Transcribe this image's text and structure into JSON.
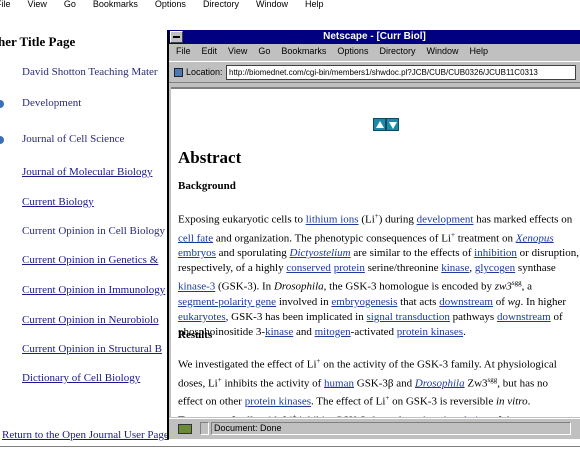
{
  "back_window": {
    "menu": [
      "File",
      "View",
      "Go",
      "Bookmarks",
      "Options",
      "Directory",
      "Window",
      "Help"
    ],
    "title": "her Title Page",
    "links": [
      {
        "label": "David Shotton Teaching Mater",
        "style": "plain"
      },
      {
        "label": "Development",
        "style": "plain"
      },
      {
        "label": "Journal of Cell Science",
        "style": "plain"
      },
      {
        "label": "Journal of Molecular Biology",
        "style": "link"
      },
      {
        "label": "Current Biology",
        "style": "link"
      },
      {
        "label": "Current Opinion in Cell Biology",
        "style": "plain"
      },
      {
        "label": "Current Opinion in Genetics  &",
        "style": "link"
      },
      {
        "label": "Current Opinion in Immunology",
        "style": "link"
      },
      {
        "label": "Current Opinion in Neurobiolo",
        "style": "link"
      },
      {
        "label": "Current Opinion in Structural B",
        "style": "link"
      },
      {
        "label": "Dictionary of Cell Biology",
        "style": "link"
      }
    ],
    "return_link": "Return to the Open Journal User Page"
  },
  "front_window": {
    "title": "Netscape - [Curr Biol]",
    "menu": [
      "File",
      "Edit",
      "View",
      "Go",
      "Bookmarks",
      "Options",
      "Directory",
      "Window",
      "Help"
    ],
    "location_label": "Location:",
    "location_url": "http://biomednet.com/cgi-bin/members1/shwdoc.pl?JCB/CUB/CUB0326/JCUB11C0313",
    "nav_icons": [
      "navigate-up-icon",
      "navigate-down-icon"
    ],
    "heading": "Abstract",
    "section_background": "Background",
    "section_results": "Results",
    "status": "Document: Done"
  },
  "colors": {
    "link": "#1a3aa0",
    "titlebar": "#000080",
    "chrome": "#c0c0c0",
    "bullet": "#3a6fb8"
  }
}
